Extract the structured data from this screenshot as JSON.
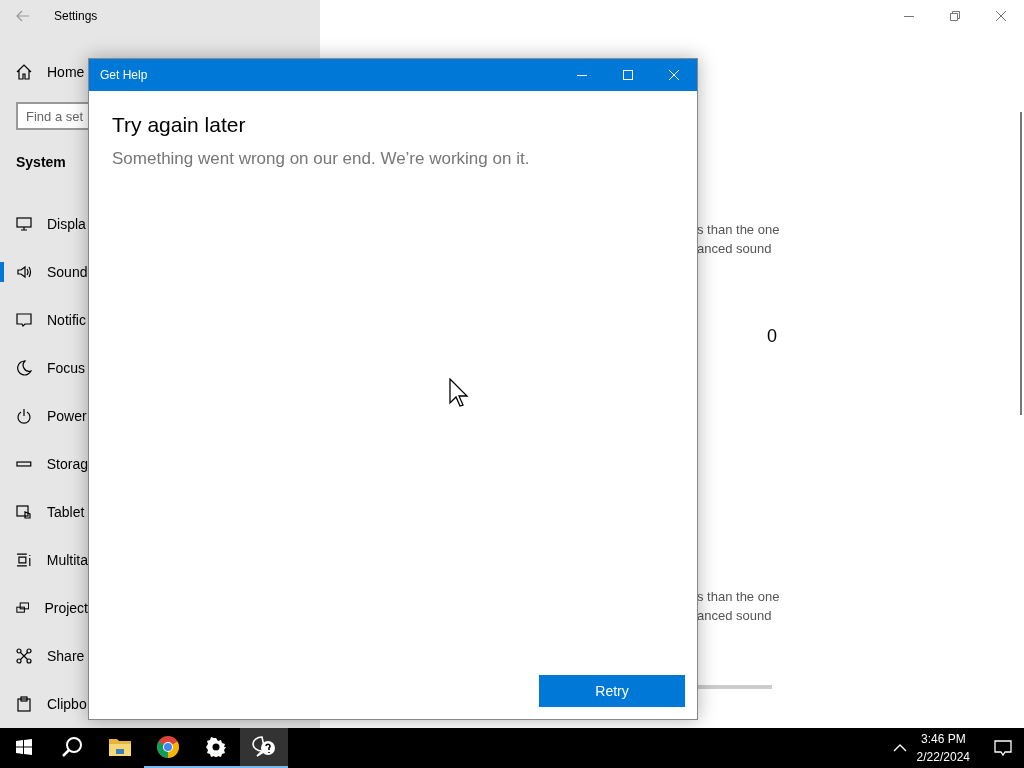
{
  "settings_window": {
    "title": "Settings",
    "home": "Home",
    "search": {
      "placeholder": "Find a set"
    },
    "section": "System",
    "sidebar_items": [
      {
        "label": "Displa",
        "selected": false
      },
      {
        "label": "Sound",
        "selected": true
      },
      {
        "label": "Notific",
        "selected": false
      },
      {
        "label": "Focus",
        "selected": false
      },
      {
        "label": "Power",
        "selected": false
      },
      {
        "label": "Storag",
        "selected": false
      },
      {
        "label": "Tablet",
        "selected": false
      },
      {
        "label": "Multita",
        "selected": false
      },
      {
        "label": "Project",
        "selected": false
      },
      {
        "label": "Share",
        "selected": false
      },
      {
        "label": "Clipbo",
        "selected": false
      }
    ],
    "content": [
      {
        "kind": "text",
        "lines": [
          "s than the one",
          "anced sound"
        ]
      },
      {
        "kind": "value",
        "text": "0"
      },
      {
        "kind": "text",
        "lines": [
          "s than the one",
          "anced sound"
        ]
      },
      {
        "kind": "slider"
      }
    ]
  },
  "dialog": {
    "title": "Get Help",
    "heading": "Try again later",
    "message": "Something went wrong on our end. We’re working on it.",
    "button": "Retry"
  },
  "taskbar": {
    "apps": [
      {
        "open": false,
        "active": false
      },
      {
        "open": false,
        "active": false
      },
      {
        "open": true,
        "active": false
      },
      {
        "open": true,
        "active": false
      },
      {
        "open": true,
        "active": true
      }
    ],
    "time": "3:46 PM",
    "date": "2/22/2024"
  }
}
